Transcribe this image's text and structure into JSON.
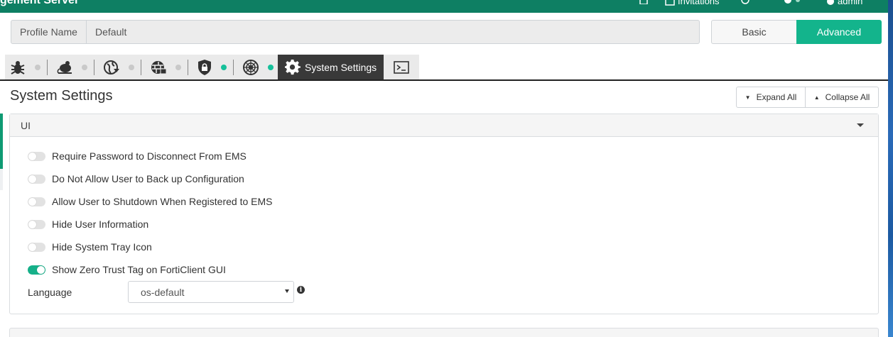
{
  "header": {
    "app_title": "gement Server",
    "invitations_label": "Invitations",
    "user_label": "admin"
  },
  "profile": {
    "name_label": "Profile Name",
    "name_value": "Default",
    "mode_basic": "Basic",
    "mode_advanced": "Advanced",
    "active_mode": "Advanced"
  },
  "tabs": {
    "items": [
      {
        "icon": "malware-bug-icon",
        "status": "grey"
      },
      {
        "icon": "sandbox-rat-icon",
        "status": "grey"
      },
      {
        "icon": "web-filter-globe-icon",
        "status": "grey"
      },
      {
        "icon": "firewall-globe-icon",
        "status": "grey"
      },
      {
        "icon": "shield-lock-icon",
        "status": "green"
      },
      {
        "icon": "network-web-icon",
        "status": "green"
      }
    ],
    "active_label": "System Settings",
    "active_icon": "gear-icon",
    "last_icon": "terminal-icon"
  },
  "page": {
    "title": "System Settings",
    "expand_all": "Expand All",
    "collapse_all": "Collapse All"
  },
  "ui_panel": {
    "title": "UI",
    "options": [
      {
        "label": "Require Password to Disconnect From EMS",
        "enabled": false
      },
      {
        "label": "Do Not Allow User to Back up Configuration",
        "enabled": false
      },
      {
        "label": "Allow User to Shutdown When Registered to EMS",
        "enabled": false
      },
      {
        "label": "Hide User Information",
        "enabled": false
      },
      {
        "label": "Hide System Tray Icon",
        "enabled": false
      },
      {
        "label": "Show Zero Trust Tag on FortiClient GUI",
        "enabled": true
      }
    ],
    "language_label": "Language",
    "language_value": "os-default"
  },
  "colors": {
    "header_bg": "#0e7f63",
    "accent": "#13b48c",
    "active_tab_bg": "#393939"
  }
}
